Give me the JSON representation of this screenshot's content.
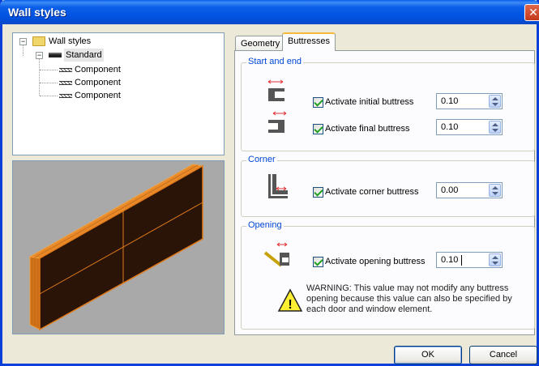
{
  "window": {
    "title": "Wall styles",
    "close_glyph": "✕"
  },
  "tree": {
    "root": {
      "label": "Wall styles",
      "expander": "−",
      "icon": "folder-icon"
    },
    "standard": {
      "label": "Standard",
      "expander": "−",
      "icon": "wall-style-icon"
    },
    "components": [
      {
        "label": "Component"
      },
      {
        "label": "Component"
      },
      {
        "label": "Component"
      }
    ]
  },
  "tabs": [
    {
      "label": "Geometry",
      "active": false
    },
    {
      "label": "Buttresses",
      "active": true
    }
  ],
  "groups": {
    "start_end": {
      "title": "Start and end",
      "initial": {
        "label": "Activate initial buttress",
        "checked": true,
        "value": "0.10"
      },
      "final": {
        "label": "Activate final buttress",
        "checked": true,
        "value": "0.10"
      }
    },
    "corner": {
      "title": "Corner",
      "corner": {
        "label": "Activate corner buttress",
        "checked": true,
        "value": "0.00"
      }
    },
    "opening": {
      "title": "Opening",
      "opening": {
        "label": "Activate opening buttress",
        "checked": true,
        "value": "0.10"
      },
      "warning": "WARNING: This value may not modify any buttress opening because this value can also be specified by each door and window element."
    }
  },
  "buttons": {
    "ok": "OK",
    "cancel": "Cancel"
  },
  "colors": {
    "accent": "#0046d5",
    "wall_fill": "#2a1408",
    "wall_edge": "#e07a1a",
    "preview_bg": "#a9a9a9"
  }
}
